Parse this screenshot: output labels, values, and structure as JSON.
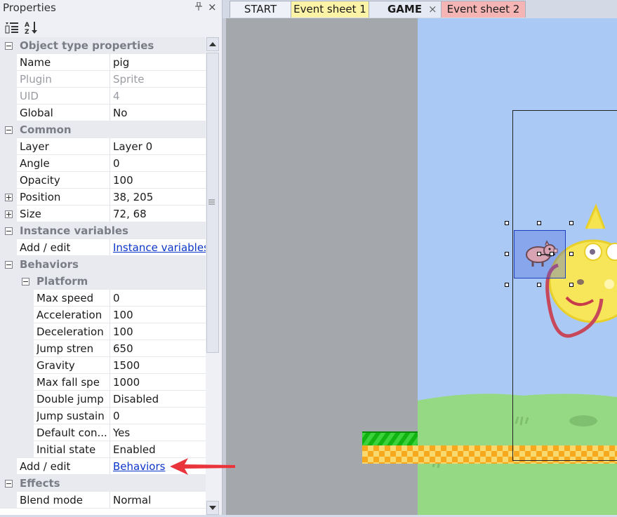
{
  "panel": {
    "title": "Properties",
    "pin_glyph": "⌘",
    "close_glyph": "×",
    "toolbar": {
      "categorized_icon": "categorized-view-icon",
      "alphabetical_icon": "sort-az-icon"
    }
  },
  "properties": {
    "object_type": {
      "label": "Object type properties",
      "name": {
        "label": "Name",
        "value": "pig"
      },
      "plugin": {
        "label": "Plugin",
        "value": "Sprite"
      },
      "uid": {
        "label": "UID",
        "value": "4"
      },
      "global": {
        "label": "Global",
        "value": "No"
      }
    },
    "common": {
      "label": "Common",
      "layer": {
        "label": "Layer",
        "value": "Layer 0"
      },
      "angle": {
        "label": "Angle",
        "value": "0"
      },
      "opacity": {
        "label": "Opacity",
        "value": "100"
      },
      "position": {
        "label": "Position",
        "value": "38, 205"
      },
      "size": {
        "label": "Size",
        "value": "72, 68"
      }
    },
    "instance_variables": {
      "label": "Instance variables",
      "add_edit": {
        "label": "Add / edit",
        "link": "Instance variables"
      }
    },
    "behaviors": {
      "label": "Behaviors",
      "platform": {
        "label": "Platform",
        "max_speed": {
          "label": "Max speed",
          "value": "0"
        },
        "acceleration": {
          "label": "Acceleration",
          "value": "100"
        },
        "deceleration": {
          "label": "Deceleration",
          "value": "100"
        },
        "jump_strength": {
          "label": "Jump stren",
          "value": "650"
        },
        "gravity": {
          "label": "Gravity",
          "value": "1500"
        },
        "max_fall_speed": {
          "label": "Max fall spe",
          "value": "1000"
        },
        "double_jump": {
          "label": "Double jump",
          "value": "Disabled"
        },
        "jump_sustain": {
          "label": "Jump sustain",
          "value": "0"
        },
        "default_controls": {
          "label": "Default con...",
          "value": "Yes"
        },
        "initial_state": {
          "label": "Initial state",
          "value": "Enabled"
        }
      },
      "add_edit": {
        "label": "Add / edit",
        "link": "Behaviors"
      }
    },
    "effects": {
      "label": "Effects",
      "blend_mode": {
        "label": "Blend mode",
        "value": "Normal"
      }
    }
  },
  "tabs": [
    {
      "label": "START",
      "color": "#eef1f8"
    },
    {
      "label": "Event sheet 1",
      "color": "#fdf3a6"
    },
    {
      "label": "GAME",
      "color": "#e4e9f4",
      "active": true,
      "close": "×"
    },
    {
      "label": "Event sheet 2",
      "color": "#f5b5b5"
    }
  ],
  "colors": {
    "sky": "#abc9f5",
    "grass": "#96d985",
    "ground_stripe": "#18c018",
    "ground_checker_a": "#f7b52c",
    "ground_checker_b": "#f8d86f",
    "selection": "#1f3fbf",
    "arrow": "#e8343a"
  }
}
